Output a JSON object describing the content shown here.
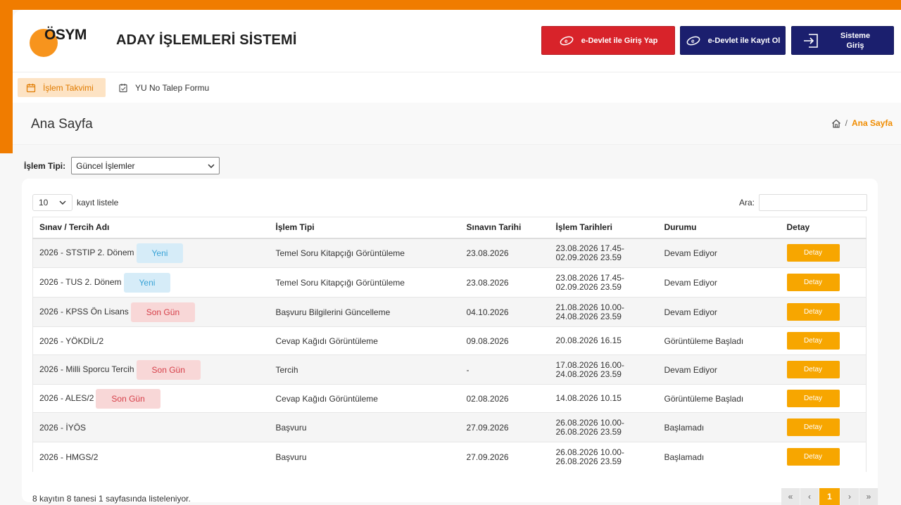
{
  "header": {
    "logo_text": "ÖSYM",
    "title": "ADAY İŞLEMLERİ SİSTEMİ",
    "edevlet_login_label": "e-Devlet ile Giriş Yap",
    "edevlet_register_label": "e-Devlet ile Kayıt Ol",
    "system_login_label_line1": "Sisteme",
    "system_login_label_line2": "Giriş"
  },
  "menu": {
    "items": [
      {
        "label": "İşlem Takvimi",
        "icon": "calendar-icon"
      },
      {
        "label": "YU No Talep Formu",
        "icon": "form-icon"
      }
    ]
  },
  "page": {
    "title": "Ana Sayfa",
    "breadcrumb": {
      "separator": "/",
      "current": "Ana Sayfa"
    }
  },
  "filter": {
    "label": "İşlem Tipi:",
    "selected": "Güncel İşlemler"
  },
  "table_controls": {
    "length_value": "10",
    "length_label": "kayıt listele",
    "search_label": "Ara:"
  },
  "table": {
    "headers": [
      "Sınav / Tercih Adı",
      "İşlem Tipi",
      "Sınavın Tarihi",
      "İşlem Tarihleri",
      "Durumu",
      "Detay"
    ],
    "rows": [
      {
        "name": "2026 - STSTIP 2. Dönem",
        "badge": "Yeni",
        "type": "Temel Soru Kitapçığı Görüntüleme",
        "exam_date": "23.08.2026",
        "dates_1": "23.08.2026 17.45-",
        "dates_2": "02.09.2026 23.59",
        "status": "Devam Ediyor",
        "detail": "Detay"
      },
      {
        "name": "2026 - TUS 2. Dönem",
        "badge": "Yeni",
        "type": "Temel Soru Kitapçığı Görüntüleme",
        "exam_date": "23.08.2026",
        "dates_1": "23.08.2026 17.45-",
        "dates_2": "02.09.2026 23.59",
        "status": "Devam Ediyor",
        "detail": "Detay"
      },
      {
        "name": "2026 - KPSS Ön Lisans",
        "badge": "Son Gün",
        "type": "Başvuru Bilgilerini Güncelleme",
        "exam_date": "04.10.2026",
        "dates_1": "21.08.2026 10.00-",
        "dates_2": "24.08.2026 23.59",
        "status": "Devam Ediyor",
        "detail": "Detay"
      },
      {
        "name": "2026 - YÖKDİL/2",
        "badge": "",
        "type": "Cevap Kağıdı Görüntüleme",
        "exam_date": "09.08.2026",
        "dates_1": "20.08.2026 16.15",
        "dates_2": "",
        "status": "Görüntüleme Başladı",
        "detail": "Detay"
      },
      {
        "name": "2026 - Milli Sporcu Tercih",
        "badge": "Son Gün",
        "type": "Tercih",
        "exam_date": "-",
        "dates_1": "17.08.2026 16.00-",
        "dates_2": "24.08.2026 23.59",
        "status": "Devam Ediyor",
        "detail": "Detay"
      },
      {
        "name": "2026 - ALES/2",
        "badge": "Son Gün",
        "type": "Cevap Kağıdı Görüntüleme",
        "exam_date": "02.08.2026",
        "dates_1": "14.08.2026 10.15",
        "dates_2": "",
        "status": "Görüntüleme Başladı",
        "detail": "Detay"
      },
      {
        "name": "2026 - İYÖS",
        "badge": "",
        "type": "Başvuru",
        "exam_date": "27.09.2026",
        "dates_1": "26.08.2026 10.00-",
        "dates_2": "26.08.2026 23.59",
        "status": "Başlamadı",
        "detail": "Detay"
      },
      {
        "name": "2026 - HMGS/2",
        "badge": "",
        "type": "Başvuru",
        "exam_date": "27.09.2026",
        "dates_1": "26.08.2026 10.00-",
        "dates_2": "26.08.2026 23.59",
        "status": "Başlamadı",
        "detail": "Detay"
      }
    ]
  },
  "footer": {
    "info": "8 kayıtın 8 tanesi 1 sayfasında listeleniyor.",
    "pager": [
      "«",
      "‹",
      "1",
      "›",
      "»"
    ]
  },
  "colors": {
    "brand_orange": "#f07c00",
    "edevlet_red": "#d8232a",
    "navy": "#1b1f6e",
    "detail_button": "#f7a600"
  }
}
